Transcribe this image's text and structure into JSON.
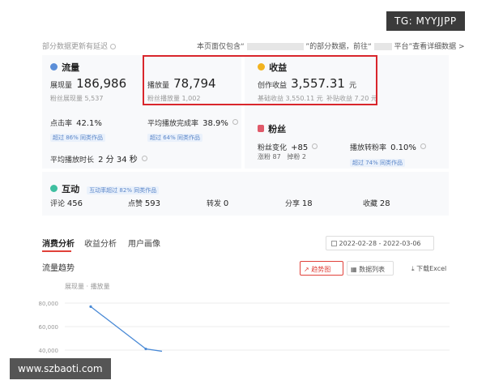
{
  "watermark": {
    "top_right": "TG: MYYJJPP",
    "bottom_left": "www.szbaoti.com"
  },
  "notice": {
    "left": "部分数据更新有延迟",
    "right_prefix": "本页面仅包含“",
    "right_mid": "”的部分数据，前往“",
    "right_suffix": "平台”查看详细数据 >"
  },
  "traffic": {
    "title": "流量",
    "exposure_label": "展现量",
    "exposure_value": "186,986",
    "fan_exposure_label": "粉丝展现量",
    "fan_exposure_value": "5,537",
    "plays_label": "播放量",
    "plays_value": "78,794",
    "fan_plays_label": "粉丝播放量",
    "fan_plays_value": "1,002",
    "ctr_label": "点击率",
    "ctr_value": "42.1%",
    "ctr_badge": "超过 86% 同类作品",
    "completion_label": "平均播放完成率",
    "completion_value": "38.9%",
    "completion_badge": "超过 64% 同类作品",
    "duration_label": "平均播放时长",
    "duration_value": "2 分 34 秒"
  },
  "income": {
    "title": "收益",
    "creation_label": "创作收益",
    "creation_value": "3,557.31",
    "unit": "元",
    "basic_label": "基础收益",
    "basic_value": "3,550.11 元",
    "subsidy_label": "补贴收益",
    "subsidy_value": "7.20 元"
  },
  "fans": {
    "title": "粉丝",
    "change_label": "粉丝变化",
    "change_value": "+85",
    "gain_label": "涨粉",
    "gain_value": "87",
    "lose_label": "掉粉",
    "lose_value": "2",
    "conv_label": "播放转粉率",
    "conv_value": "0.10%",
    "conv_badge": "超过 74% 同类作品"
  },
  "interaction": {
    "title": "互动",
    "badge": "互动率超过 82% 同类作品",
    "comments_label": "评论",
    "comments_value": "456",
    "likes_label": "点赞",
    "likes_value": "593",
    "shares_label": "转发",
    "shares_value": "0",
    "share2_label": "分享",
    "share2_value": "18",
    "fav_label": "收藏",
    "fav_value": "28"
  },
  "tabs": [
    "消费分析",
    "收益分析",
    "用户画像"
  ],
  "date_range": {
    "start": "2022-02-28",
    "sep": "-",
    "end": "2022-03-06"
  },
  "chart_section": {
    "title": "流量趋势",
    "trend_btn": "趋势图",
    "table_btn": "数据列表",
    "download_btn": "下载Excel"
  },
  "chart_data": {
    "type": "line",
    "legend": "展现量 · 播放量",
    "yticks": [
      "80,000",
      "60,000",
      "40,000"
    ],
    "ylim": [
      40000,
      80000
    ],
    "series": [
      {
        "name": "展现量",
        "x": [
          1,
          2,
          3
        ],
        "values": [
          77000,
          41000,
          39000
        ]
      }
    ],
    "colors": {
      "line": "#4a8ad6"
    }
  },
  "colors": {
    "highlight": "#d9262c",
    "badge": "#5b86c9",
    "accent_red": "#e0413a"
  }
}
